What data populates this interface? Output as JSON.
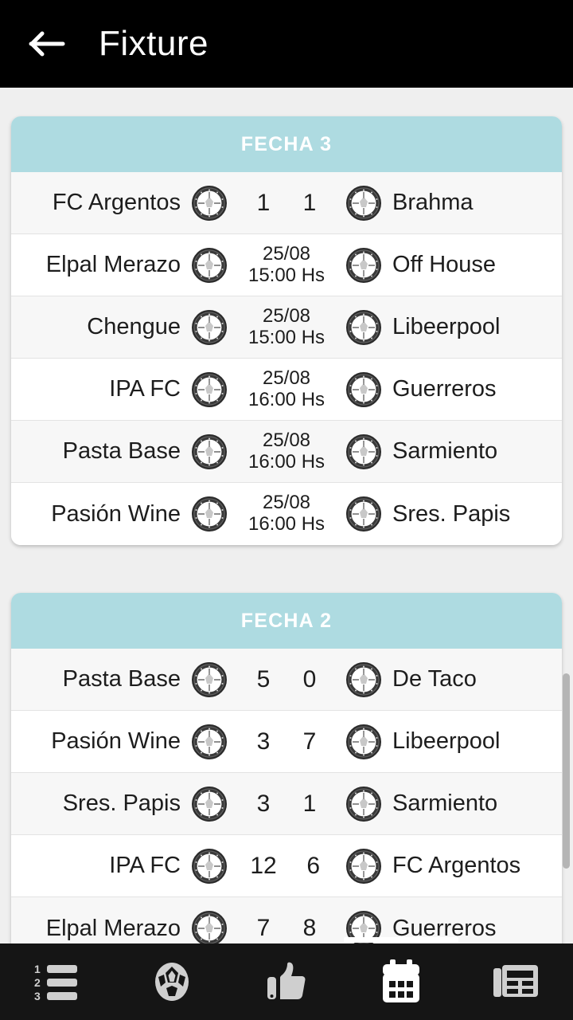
{
  "appbar": {
    "back_icon": "arrow-left-icon",
    "title": "Fixture"
  },
  "fixtures": [
    {
      "header": "FECHA 3",
      "matches": [
        {
          "home": "FC Argentos",
          "away": "Brahma",
          "type": "score",
          "home_score": "1",
          "away_score": "1"
        },
        {
          "home": "Elpal Merazo",
          "away": "Off House",
          "type": "scheduled",
          "date": "25/08",
          "time": "15:00 Hs"
        },
        {
          "home": "Chengue",
          "away": "Libeerpool",
          "type": "scheduled",
          "date": "25/08",
          "time": "15:00 Hs"
        },
        {
          "home": "IPA FC",
          "away": "Guerreros",
          "type": "scheduled",
          "date": "25/08",
          "time": "16:00 Hs"
        },
        {
          "home": "Pasta Base",
          "away": "Sarmiento",
          "type": "scheduled",
          "date": "25/08",
          "time": "16:00 Hs"
        },
        {
          "home": "Pasión Wine",
          "away": "Sres. Papis",
          "type": "scheduled",
          "date": "25/08",
          "time": "16:00 Hs"
        }
      ]
    },
    {
      "header": "FECHA 2",
      "matches": [
        {
          "home": "Pasta Base",
          "away": "De Taco",
          "type": "score",
          "home_score": "5",
          "away_score": "0"
        },
        {
          "home": "Pasión Wine",
          "away": "Libeerpool",
          "type": "score",
          "home_score": "3",
          "away_score": "7"
        },
        {
          "home": "Sres. Papis",
          "away": "Sarmiento",
          "type": "score",
          "home_score": "3",
          "away_score": "1"
        },
        {
          "home": "IPA FC",
          "away": "FC Argentos",
          "type": "score",
          "home_score": "12",
          "away_score": "6"
        },
        {
          "home": "Elpal Merazo",
          "away": "Guerreros",
          "type": "score",
          "home_score": "7",
          "away_score": "8"
        }
      ]
    }
  ],
  "bottom_nav": {
    "items": [
      {
        "name": "nav-standings",
        "icon": "numbered-list-icon",
        "active": false
      },
      {
        "name": "nav-matches",
        "icon": "soccer-ball-icon",
        "active": false
      },
      {
        "name": "nav-likes",
        "icon": "thumbs-up-icon",
        "active": false
      },
      {
        "name": "nav-fixture",
        "icon": "calendar-icon",
        "active": true
      },
      {
        "name": "nav-news",
        "icon": "news-icon",
        "active": false
      }
    ]
  },
  "colors": {
    "appbar_bg": "#000000",
    "page_bg": "#efefef",
    "section_header_bg": "#aedbe1",
    "row_bg": "#ffffff",
    "row_alt_bg": "#f7f7f7",
    "nav_bg": "#151515",
    "nav_active": "#ffffff"
  }
}
